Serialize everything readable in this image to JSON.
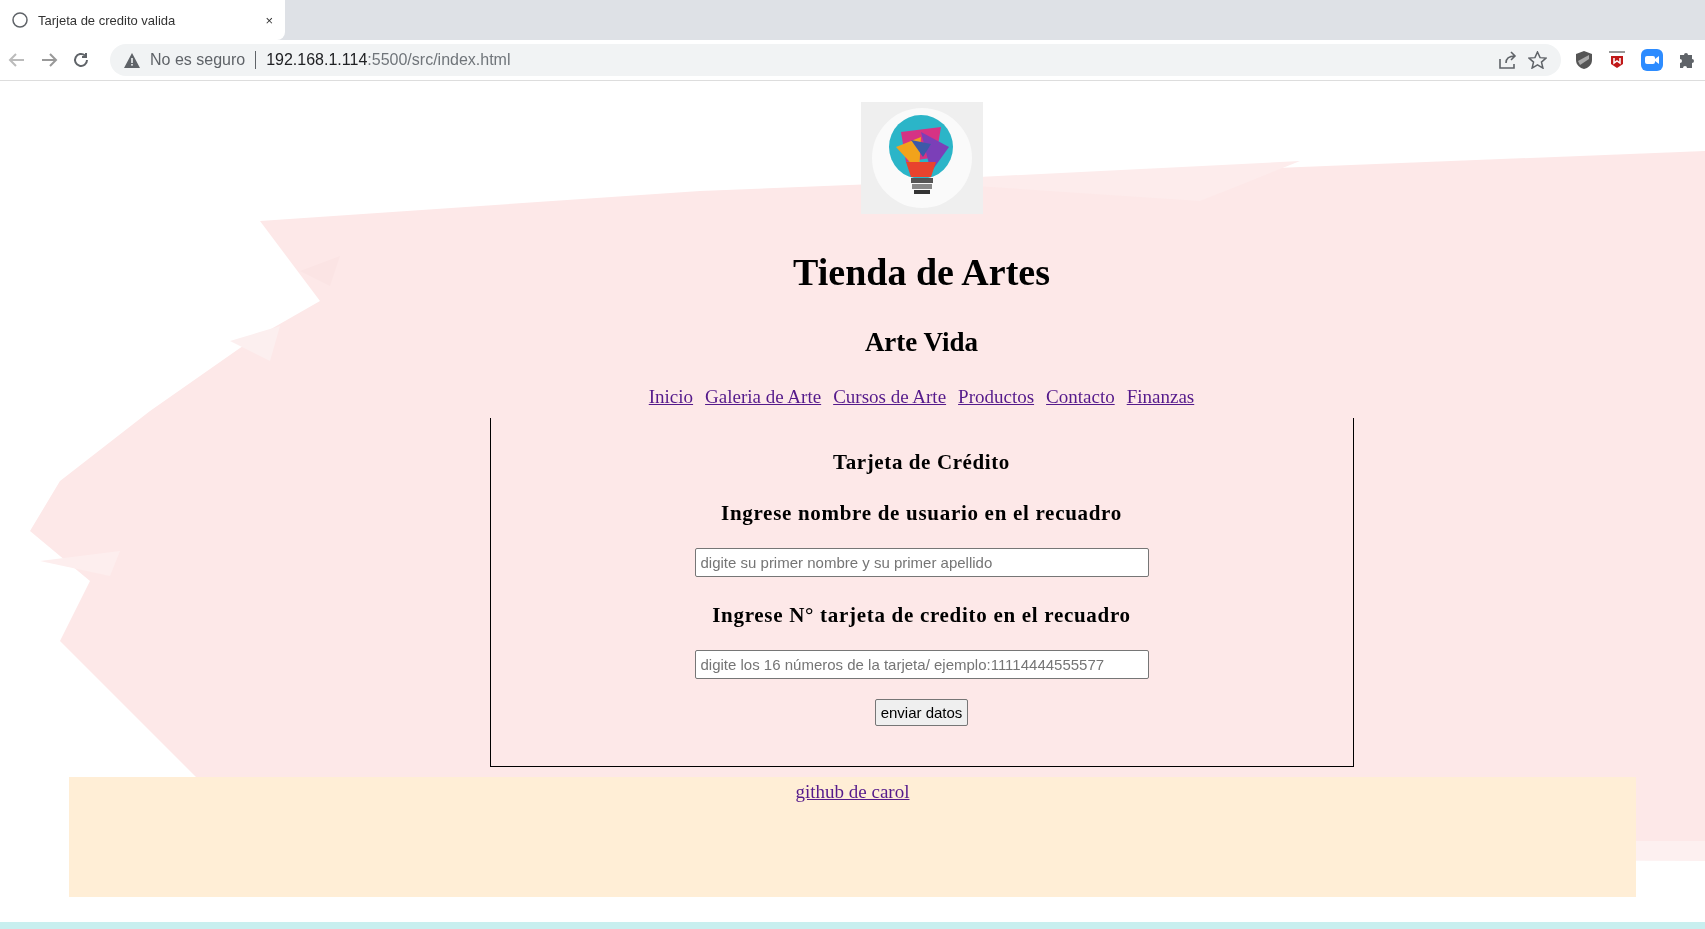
{
  "browser": {
    "tab_title": "Tarjeta de credito valida",
    "tab_close": "×",
    "security": "No es seguro",
    "url": "192.168.1.114:5500/src/index.html"
  },
  "header": {
    "title": "Tienda de Artes",
    "subtitle": "Arte Vida"
  },
  "nav": [
    {
      "label": "Inicio"
    },
    {
      "label": "Galeria de Arte"
    },
    {
      "label": "Cursos de Arte"
    },
    {
      "label": "Productos"
    },
    {
      "label": "Contacto"
    },
    {
      "label": "Finanzas"
    }
  ],
  "form": {
    "title": "Tarjeta de Crédito",
    "fields": [
      {
        "label": "Ingrese nombre de usuario en el recuadro",
        "placeholder": "digite su primer nombre y su primer apellido"
      },
      {
        "label": "Ingrese N° tarjeta de credito en el recuadro",
        "placeholder": "digite los 16 números de la tarjeta/ ejemplo:11114444555577"
      }
    ],
    "button": "enviar datos"
  },
  "footer": {
    "link": "github de carol"
  }
}
